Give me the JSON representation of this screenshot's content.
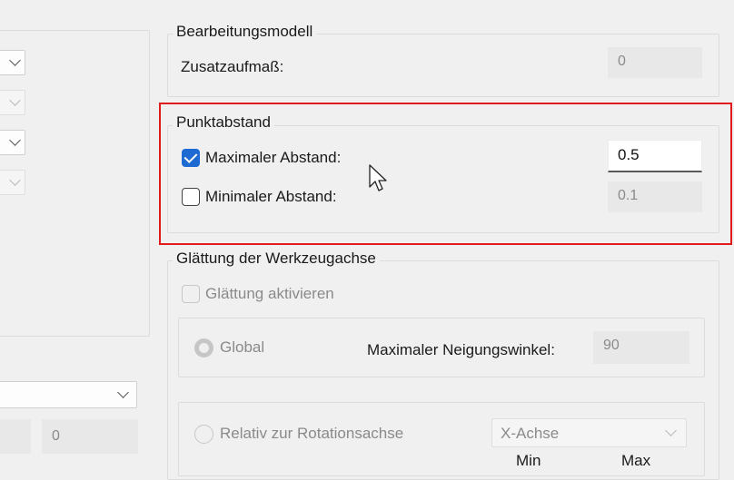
{
  "bearbeitungsmodell": {
    "title": "Bearbeitungsmodell",
    "zusatz_label": "Zusatzaufmaß:",
    "zusatz_value": "0"
  },
  "punktabstand": {
    "title": "Punktabstand",
    "max_label": "Maximaler Abstand:",
    "max_checked": true,
    "max_value": "0.5",
    "min_label": "Minimaler Abstand:",
    "min_checked": false,
    "min_value": "0.1"
  },
  "glaettung": {
    "title": "Glättung der Werkzeugachse",
    "enable_label": "Glättung aktivieren",
    "global_label": "Global",
    "neigung_label": "Maximaler Neigungswinkel:",
    "neigung_value": "90",
    "relativ_label": "Relativ zur Rotationsachse",
    "achse_selected": "X-Achse",
    "col_min": "Min",
    "col_max": "Max"
  },
  "left_panel": {
    "bottom_field_value": "0"
  },
  "colors": {
    "highlight_border": "#e11b1b",
    "checkbox_accent": "#1d6ad2"
  }
}
